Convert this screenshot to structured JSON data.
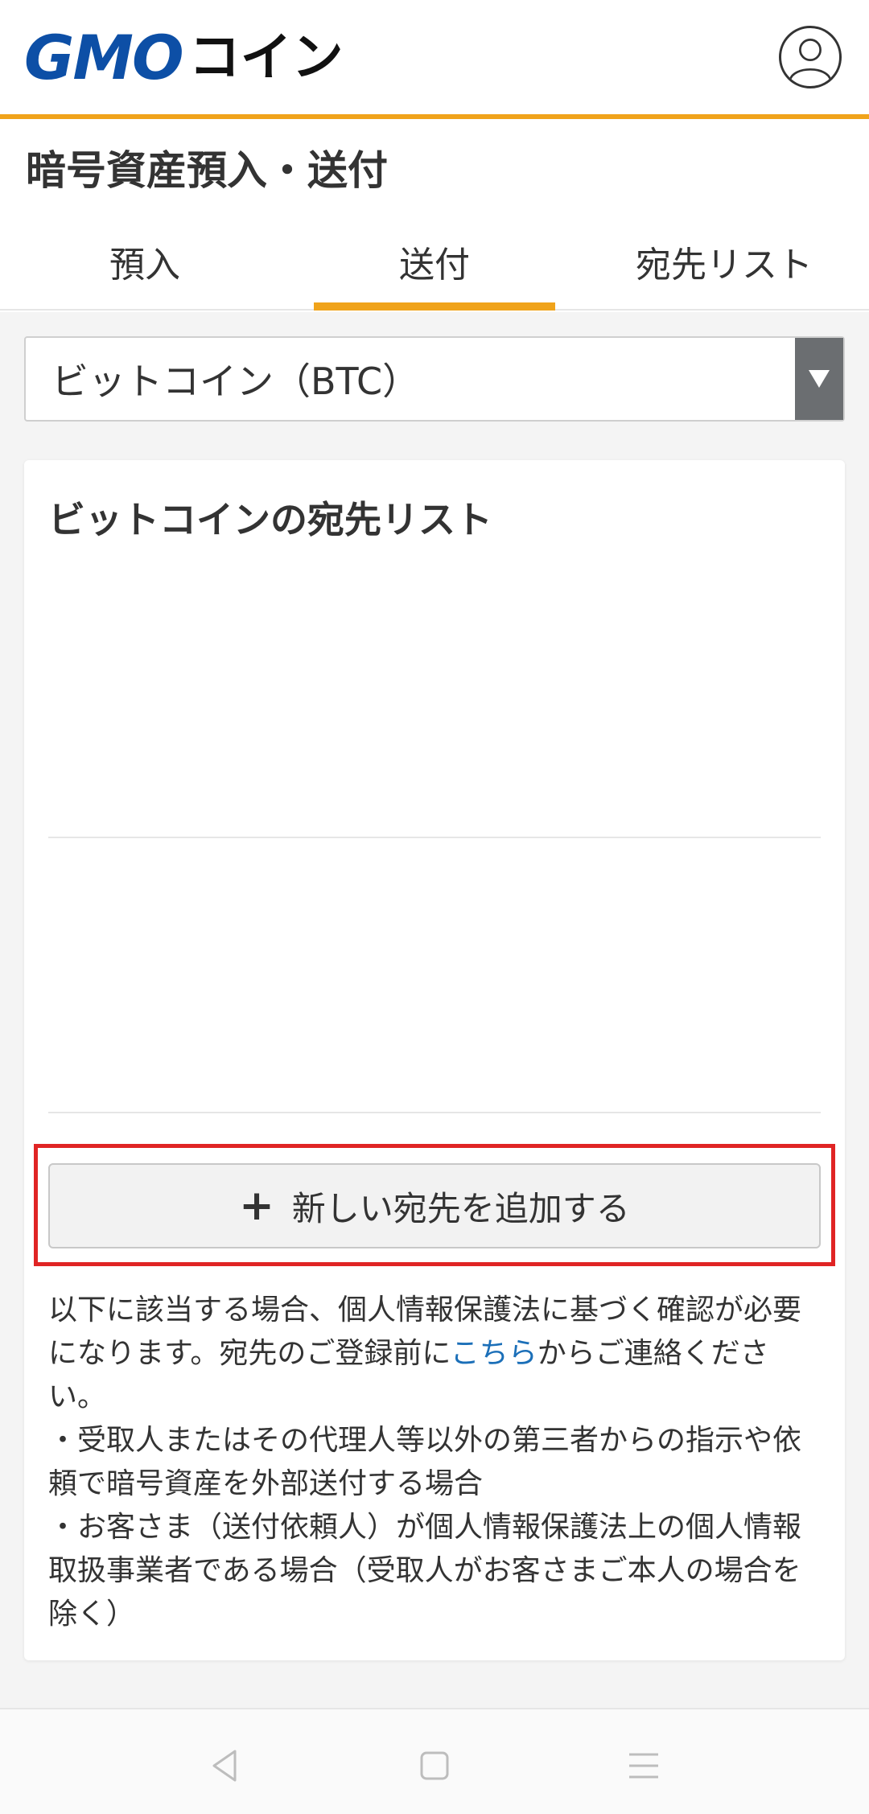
{
  "header": {
    "logo_main": "GMO",
    "logo_sub": "コイン"
  },
  "page": {
    "title": "暗号資産預入・送付"
  },
  "tabs": [
    {
      "label": "預入",
      "active": false
    },
    {
      "label": "送付",
      "active": true
    },
    {
      "label": "宛先リスト",
      "active": false
    }
  ],
  "coin_select": {
    "selected": "ビットコイン（BTC）"
  },
  "card": {
    "title": "ビットコインの宛先リスト",
    "add_button_label": "新しい宛先を追加する",
    "add_button_icon": "plus-icon"
  },
  "notice": {
    "line1_prefix": "以下に該当する場合、個人情報保護法に基づく確認が必要になります。宛先のご登録前に",
    "link_text": "こちら",
    "line1_suffix": "からご連絡ください。",
    "item1": "・受取人またはその代理人等以外の第三者からの指示や依頼で暗号資産を外部送付する場合",
    "item2": "・お客さま（送付依頼人）が個人情報保護法上の個人情報取扱事業者である場合（受取人がお客さまご本人の場合を除く）"
  },
  "colors": {
    "accent": "#f0a31b",
    "brand_blue": "#0d4fa6",
    "brand_red": "#e3161f",
    "link": "#1b6fb8",
    "highlight": "#e02424"
  }
}
